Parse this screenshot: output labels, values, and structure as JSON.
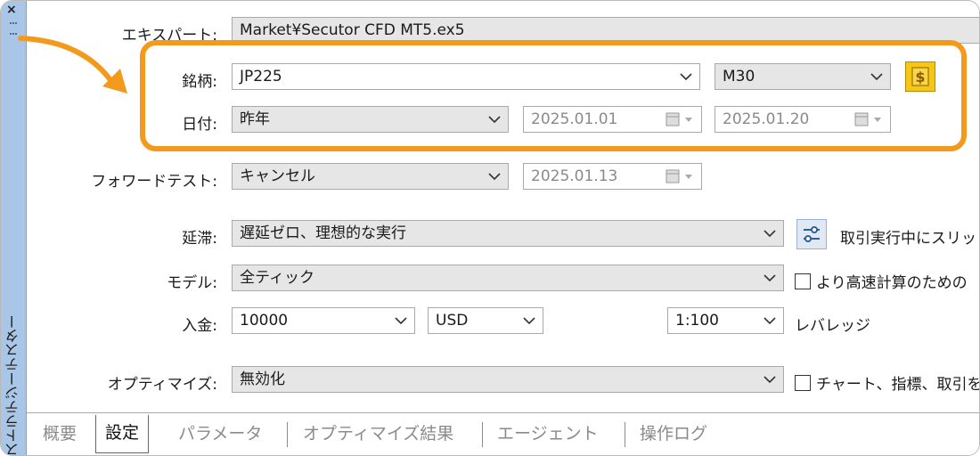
{
  "side_panel": {
    "title": "ストラテジーテスター",
    "close_glyph": "×"
  },
  "form": {
    "expert": {
      "label": "エキスパート:",
      "value": "Market¥Secutor CFD MT5.ex5"
    },
    "symbol": {
      "label": "銘柄:",
      "value": "JP225",
      "timeframe": "M30"
    },
    "date": {
      "label": "日付:",
      "range": "昨年",
      "from": "2025.01.01",
      "to": "2025.01.20"
    },
    "forward": {
      "label": "フォワードテスト:",
      "value": "キャンセル",
      "date": "2025.01.13"
    },
    "delay": {
      "label": "延滞:",
      "value": "遅延ゼロ、理想的な実行",
      "side_text": "取引実行中にスリッ"
    },
    "model": {
      "label": "モデル:",
      "value": "全ティック",
      "checkbox_text": "より高速計算のための"
    },
    "deposit": {
      "label": "入金:",
      "amount": "10000",
      "currency": "USD",
      "leverage": "1:100",
      "leverage_label": "レバレッジ"
    },
    "optimize": {
      "label": "オプティマイズ:",
      "value": "無効化",
      "checkbox_text": "チャート、指標、取引を"
    }
  },
  "tabs": [
    {
      "label": "概要"
    },
    {
      "label": "設定"
    },
    {
      "label": "パラメータ"
    },
    {
      "label": "オプティマイズ結果"
    },
    {
      "label": "エージェント"
    },
    {
      "label": "操作ログ"
    }
  ],
  "colors": {
    "highlight": "#f39a1d",
    "side_panel": "#a9c6e6",
    "dollar_icon_bg": "#f5c518"
  },
  "icons": {
    "symbol_specs": "dollar-icon",
    "delay_settings": "sliders-icon",
    "calendar": "calendar-icon"
  }
}
